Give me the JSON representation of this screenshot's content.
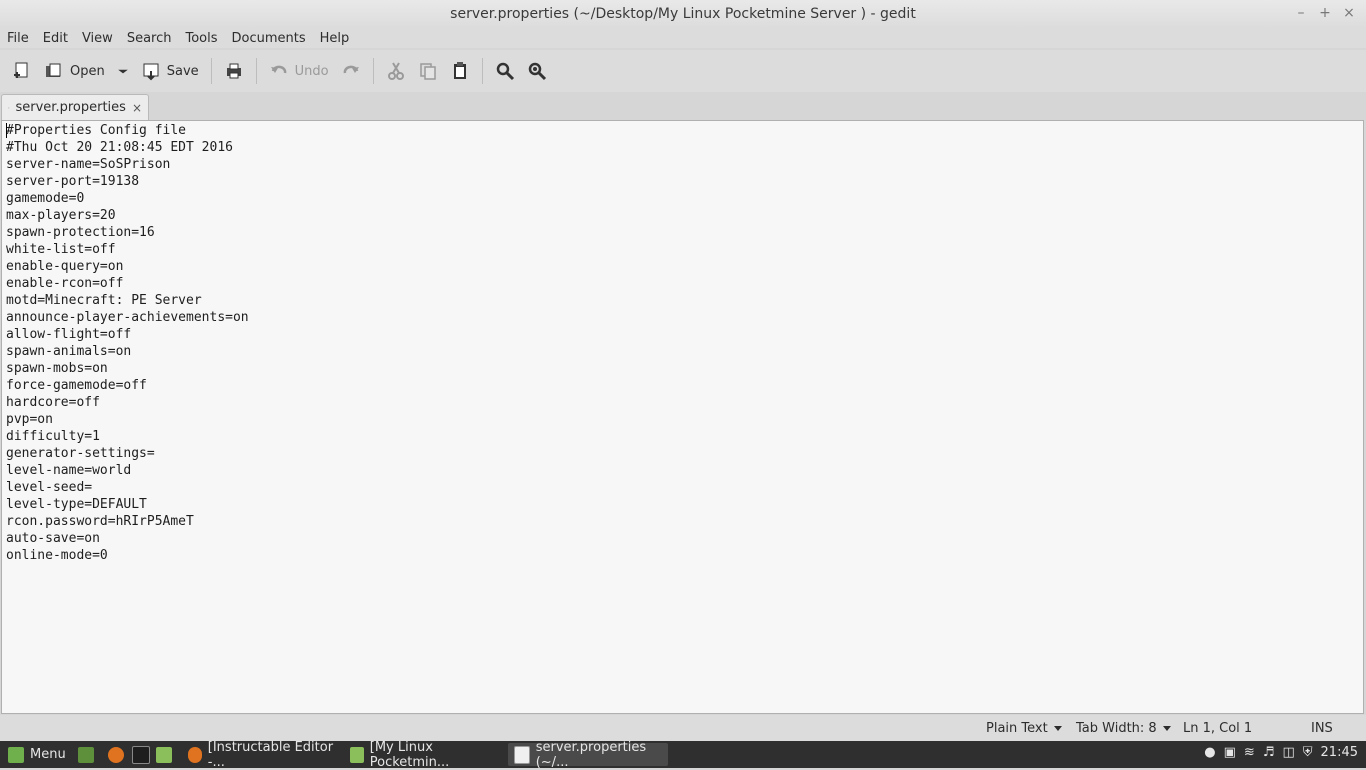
{
  "window": {
    "title": "server.properties (~/Desktop/My Linux Pocketmine Server ) - gedit",
    "controls": [
      "–",
      "+",
      "×"
    ]
  },
  "menu": [
    "File",
    "Edit",
    "View",
    "Search",
    "Tools",
    "Documents",
    "Help"
  ],
  "toolbar": {
    "open_label": "Open",
    "save_label": "Save",
    "undo_label": "Undo"
  },
  "tab": {
    "label": "server.properties",
    "close": "×"
  },
  "editor": {
    "lines": [
      "#Properties Config file",
      "#Thu Oct 20 21:08:45 EDT 2016",
      "server-name=SoSPrison",
      "server-port=19138",
      "gamemode=0",
      "max-players=20",
      "spawn-protection=16",
      "white-list=off",
      "enable-query=on",
      "enable-rcon=off",
      "motd=Minecraft: PE Server",
      "announce-player-achievements=on",
      "allow-flight=off",
      "spawn-animals=on",
      "spawn-mobs=on",
      "force-gamemode=off",
      "hardcore=off",
      "pvp=on",
      "difficulty=1",
      "generator-settings=",
      "level-name=world",
      "level-seed=",
      "level-type=DEFAULT",
      "rcon.password=hRIrP5AmeT",
      "auto-save=on",
      "online-mode=0"
    ]
  },
  "status": {
    "language": "Plain Text",
    "tab_width": "Tab Width: 8",
    "position": "Ln 1, Col 1",
    "mode": "INS"
  },
  "taskbar": {
    "menu_label": "Menu",
    "tasks": [
      "[Instructable Editor -...",
      "[My Linux Pocketmin...",
      "server.properties (~/..."
    ],
    "clock": "21:45"
  }
}
